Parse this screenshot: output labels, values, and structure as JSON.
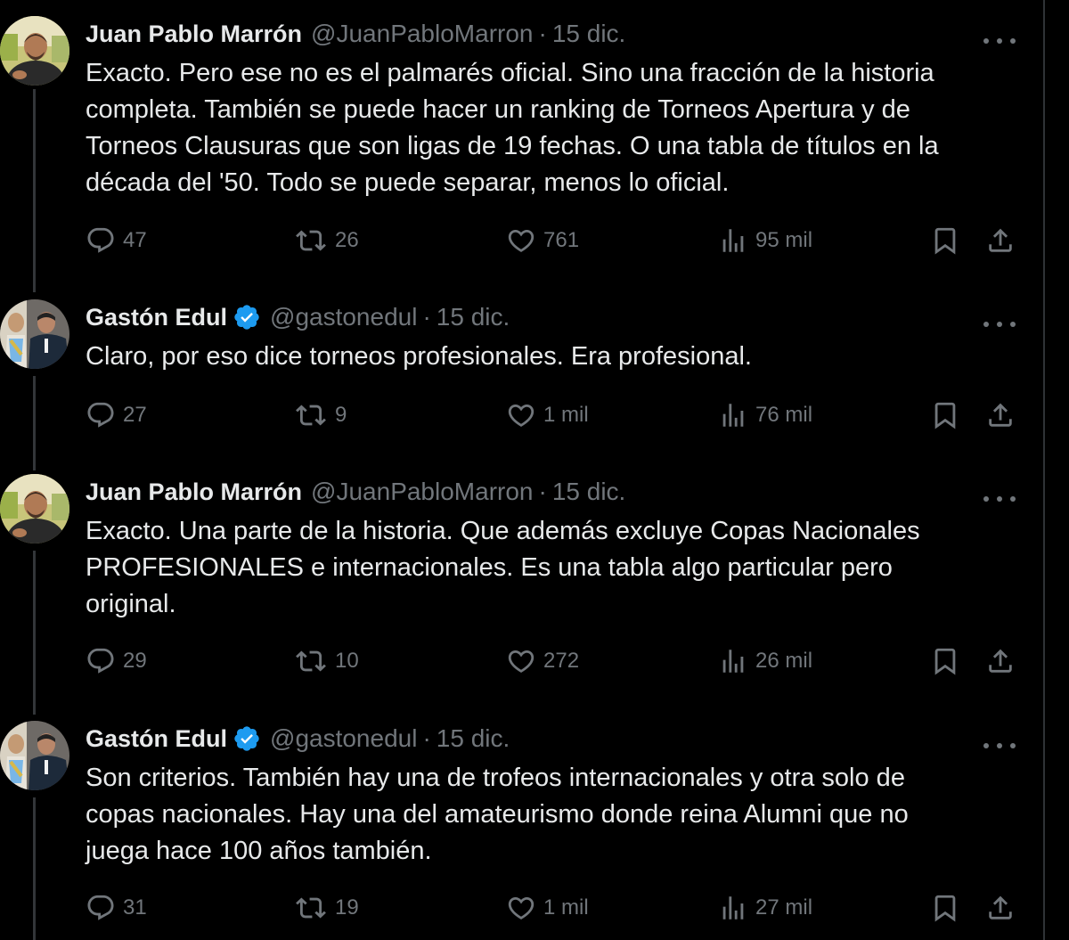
{
  "tweets": [
    {
      "name": "Juan Pablo Marrón",
      "handle": "@JuanPabloMarron",
      "separator": "·",
      "date": "15 dic.",
      "verified": false,
      "text": "Exacto. Pero ese no es el palmarés oficial. Sino una fracción de la historia\ncompleta. También se puede hacer un ranking de Torneos Apertura y de\nTorneos Clausuras que son ligas de 19 fechas. O una tabla de títulos en la\ndécada del '50. Todo se puede separar, menos lo oficial.",
      "replies": "47",
      "retweets": "26",
      "likes": "761",
      "views": "95 mil"
    },
    {
      "name": "Gastón Edul",
      "handle": "@gastonedul",
      "separator": "·",
      "date": "15 dic.",
      "verified": true,
      "text": "Claro, por eso dice torneos profesionales. Era profesional.",
      "replies": "27",
      "retweets": "9",
      "likes": "1 mil",
      "views": "76 mil"
    },
    {
      "name": "Juan Pablo Marrón",
      "handle": "@JuanPabloMarron",
      "separator": "·",
      "date": "15 dic.",
      "verified": false,
      "text": "Exacto. Una parte de la historia. Que además excluye Copas Nacionales\nPROFESIONALES e internacionales. Es una tabla algo particular pero\noriginal.",
      "replies": "29",
      "retweets": "10",
      "likes": "272",
      "views": "26 mil"
    },
    {
      "name": "Gastón Edul",
      "handle": "@gastonedul",
      "separator": "·",
      "date": "15 dic.",
      "verified": true,
      "text": "Son criterios. También hay una de trofeos internacionales y otra solo de\ncopas nacionales. Hay una del amateurismo donde reina Alumni que no\njuega hace 100 años también.",
      "replies": "31",
      "retweets": "19",
      "likes": "1 mil",
      "views": "27 mil"
    }
  ],
  "icons": {
    "reply": "reply-icon",
    "retweet": "retweet-icon",
    "like": "like-icon",
    "views": "views-icon",
    "bookmark": "bookmark-icon",
    "share": "share-icon",
    "more": "more-icon",
    "verified": "verified-badge-icon"
  },
  "colors": {
    "background": "#000000",
    "text": "#e7e9ea",
    "secondary": "#71767b",
    "verified": "#1d9bf0",
    "thread_line": "#333639"
  }
}
